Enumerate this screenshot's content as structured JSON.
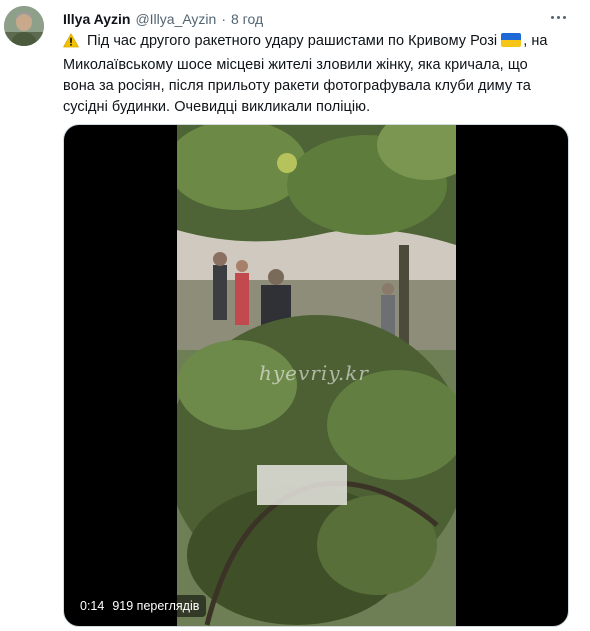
{
  "author": {
    "name": "Illya Ayzin",
    "handle": "@Illya_Ayzin",
    "separator": "·",
    "time": "8 год"
  },
  "tweet": {
    "icons": {
      "warning": "warning-icon",
      "flag": "ukraine-flag-icon"
    },
    "lines": [
      "Під час другого ракетного удару рашистами по Кривому Розі",
      ", на",
      "Миколаївському шосе місцеві жителі зловили жінку, яка кричала, що",
      "вона за росіян, після прильоту ракети фотографувала клуби диму та",
      "сусідні будинки.  Очевидці викликали поліцію."
    ]
  },
  "video": {
    "watermark": "hyevriy.kr",
    "duration": "0:14",
    "views": "919 переглядів"
  },
  "colors": {
    "text": "#0f1419",
    "muted": "#536471",
    "media_border": "#cfd9de",
    "flag_blue": "#1f69d6",
    "flag_yellow": "#f5c518",
    "warning": "#f2c200"
  }
}
